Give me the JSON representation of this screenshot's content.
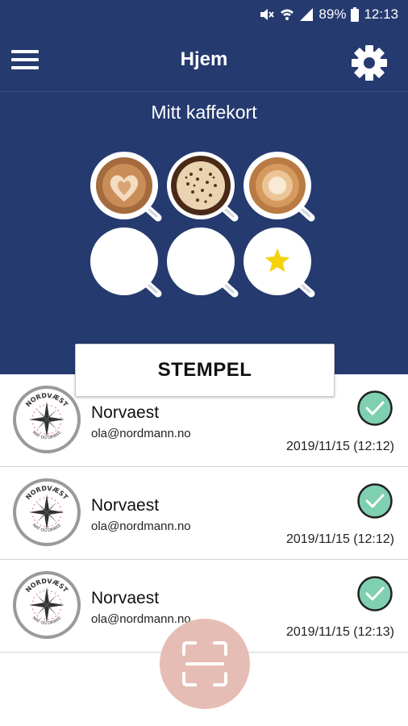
{
  "status_bar": {
    "battery": "89%",
    "time": "12:13"
  },
  "header": {
    "title": "Hjem"
  },
  "card": {
    "title": "Mitt kaffekort",
    "stamps_collected": 3,
    "stamps_total": 6,
    "reward_icon": "star-icon"
  },
  "stamp_button": {
    "label": "STEMPEL"
  },
  "history": [
    {
      "name": "Norvaest",
      "email": "ola@nordmann.no",
      "datetime": "2019/11/15 (12:12)",
      "logo_text": "NORDVÆST",
      "logo_subtext": "MAT OG DRIKKE"
    },
    {
      "name": "Norvaest",
      "email": "ola@nordmann.no",
      "datetime": "2019/11/15 (12:12)",
      "logo_text": "NORDVÆST",
      "logo_subtext": "MAT OG DRIKKE"
    },
    {
      "name": "Norvaest",
      "email": "ola@nordmann.no",
      "datetime": "2019/11/15 (12:13)",
      "logo_text": "NORDVÆST",
      "logo_subtext": "MAT OG DRIKKE"
    }
  ],
  "colors": {
    "primary": "#253a6f",
    "check": "#7fd0b0",
    "fab": "#e6bdb4",
    "star": "#f5d20a"
  }
}
